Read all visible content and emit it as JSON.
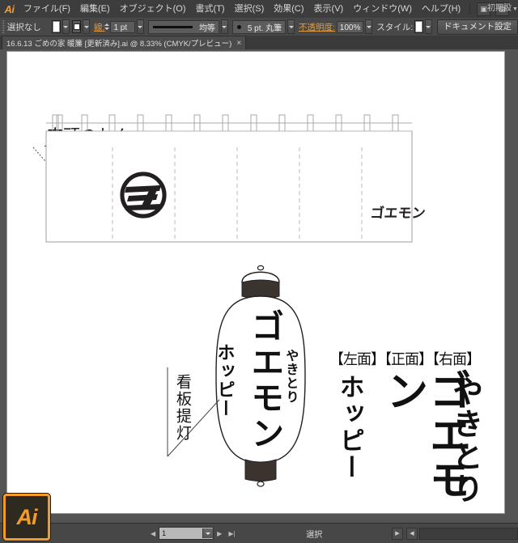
{
  "app": {
    "name": "Adobe Illustrator",
    "logo_text": "Ai",
    "taskbar_icon_label": "Ai"
  },
  "menubar": {
    "items": [
      {
        "label": "ファイル(F)"
      },
      {
        "label": "編集(E)"
      },
      {
        "label": "オブジェクト(O)"
      },
      {
        "label": "書式(T)"
      },
      {
        "label": "選択(S)"
      },
      {
        "label": "効果(C)"
      },
      {
        "label": "表示(V)"
      },
      {
        "label": "ウィンドウ(W)"
      },
      {
        "label": "ヘルプ(H)"
      }
    ],
    "bridge_icon": "br-icon",
    "arrange_icon": "arrange-documents-icon",
    "workspace_label": "初期設"
  },
  "controlbar": {
    "selection_status": "選択なし",
    "fill_swatch_color": "#ffffff",
    "stroke_swatch_color": "#ffffff",
    "stroke_label": "線:",
    "stroke_weight_value": "1 pt",
    "stroke_profile_value": "均等",
    "brush_value": "5 pt. 丸筆",
    "opacity_label": "不透明度:",
    "opacity_value": "100%",
    "style_label": "スタイル:",
    "style_swatch_color": "#ffffff",
    "document_setup_button": "ドキュメント設定"
  },
  "document_tab": {
    "title": "16.6.13 ごめの家 暖簾 [更新済み].ai @ 8.33% (CMYK/プレビュー)",
    "close_icon": "close-icon"
  },
  "artwork": {
    "noren_section": {
      "title": "店頭のれん",
      "logo_name": "circular-goemon-crest",
      "brand_text": "ゴエモン",
      "hanger_loop_count": 13,
      "panel_divider_count": 5
    },
    "lantern_section": {
      "callout_label": "看板提灯",
      "faces_label": "【左面】【正面】【右面】",
      "lantern_front_text": "ゴエモン",
      "lantern_left_text": "ホッピー",
      "lantern_right_text": "やきとり",
      "side_left_text": "ホッピー",
      "side_front_text": "ゴエモン",
      "side_right_text": "やきとり"
    }
  },
  "statusbar": {
    "zoom_value": "1",
    "status_text": "選択",
    "first_icon": "first-page-icon",
    "prev_icon": "previous-page-icon",
    "next_icon": "next-page-icon",
    "last_icon": "last-page-icon"
  },
  "colors": {
    "accent": "#f59b2a",
    "chrome": "#535353",
    "panel": "#484848",
    "ink": "#231f20"
  }
}
